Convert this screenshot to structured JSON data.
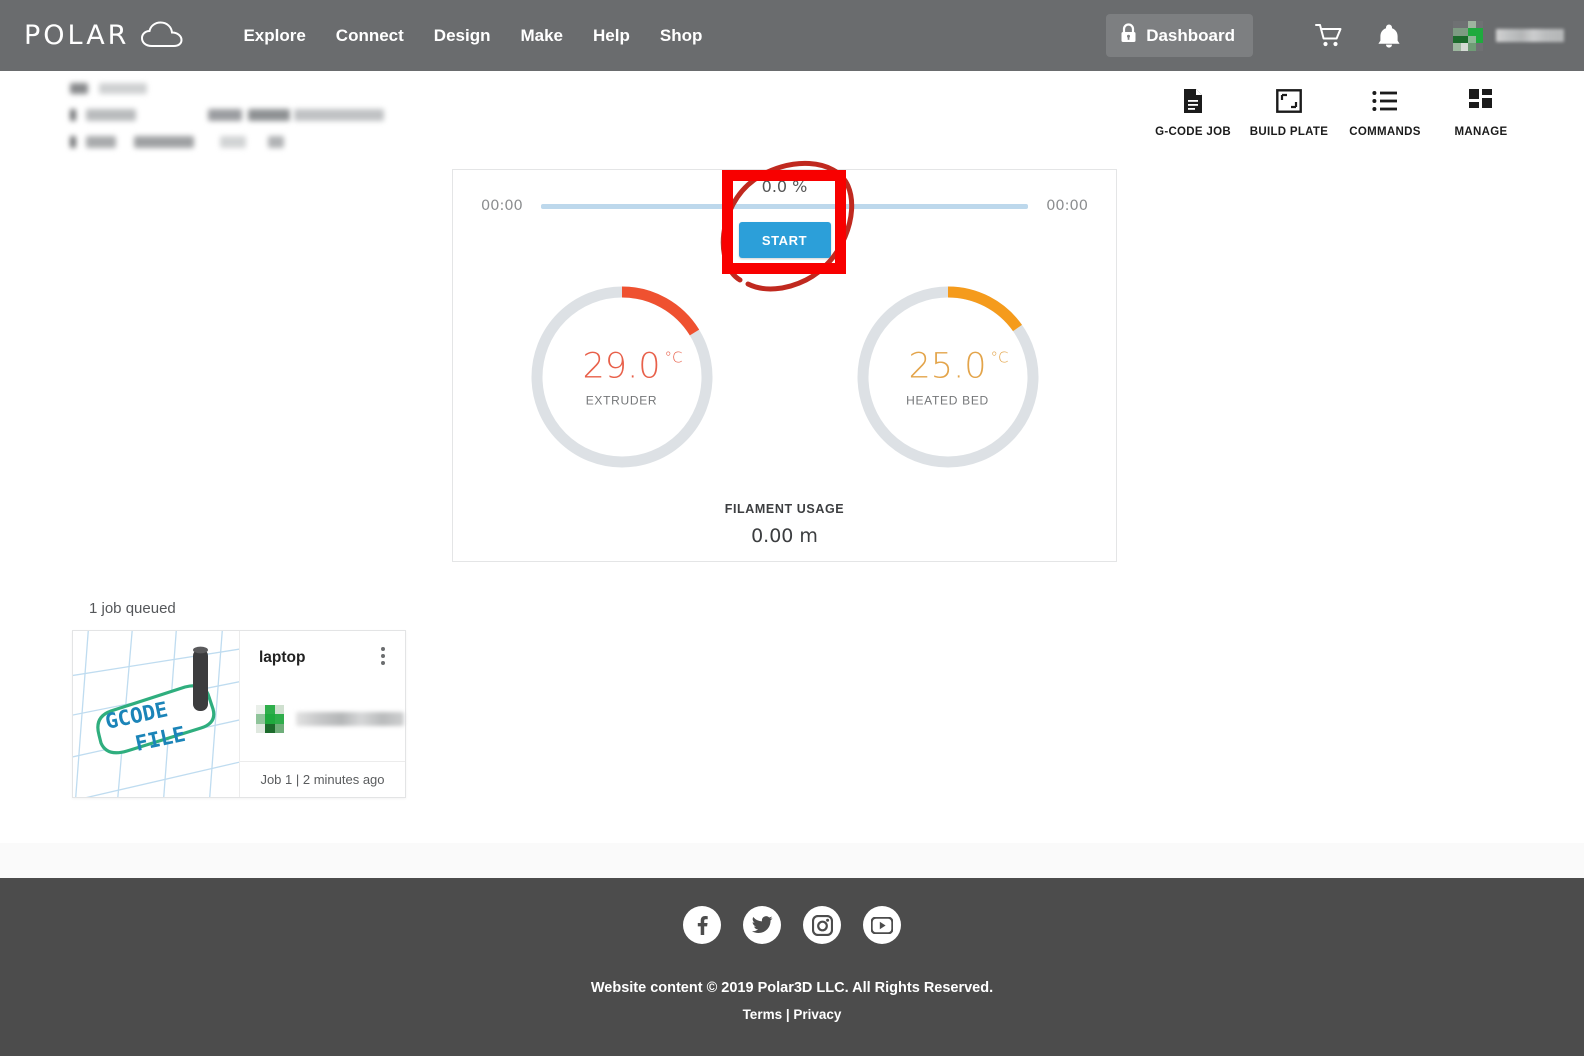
{
  "header": {
    "logo_text": "POLAR",
    "logo_icon": "cloud-icon",
    "nav": [
      {
        "label": "Explore"
      },
      {
        "label": "Connect"
      },
      {
        "label": "Design"
      },
      {
        "label": "Make"
      },
      {
        "label": "Help"
      },
      {
        "label": "Shop"
      }
    ],
    "dashboard_button": {
      "label": "Dashboard",
      "icon": "lock-icon"
    },
    "cart_icon": "shopping-cart-icon",
    "bell_icon": "notification-bell-icon",
    "avatar": "user-avatar-identicon",
    "username": "",
    "bg_color": "#6a6c6e"
  },
  "toolbar": {
    "items": [
      {
        "label": "G-CODE JOB",
        "icon": "document-icon"
      },
      {
        "label": "BUILD PLATE",
        "icon": "build-plate-frame-icon"
      },
      {
        "label": "COMMANDS",
        "icon": "list-icon"
      },
      {
        "label": "MANAGE",
        "icon": "grid-blocks-icon"
      }
    ]
  },
  "printer": {
    "name_redacted": "",
    "progress": {
      "elapsed": "00:00",
      "remaining": "00:00",
      "percent_label": "0.0 %",
      "percent_value": 0,
      "track_color": "#bdd8ec"
    },
    "start_button": {
      "label": "START",
      "color": "#2c9fd9"
    },
    "gauges": [
      {
        "name": "EXTRUDER",
        "value": "29.0",
        "unit": "°C",
        "color": "#ef5130",
        "track_color": "#dde1e5",
        "arc_fraction": 0.155
      },
      {
        "name": "HEATED BED",
        "value": "25.0",
        "unit": "°C",
        "color": "#f59b1c",
        "track_color": "#dde1e5",
        "arc_fraction": 0.145
      }
    ],
    "filament": {
      "label": "FILAMENT USAGE",
      "value": "0.00 m"
    }
  },
  "annotation": {
    "shape": "red-rectangle-and-circle-highlight",
    "color": "#f80000",
    "target": "START"
  },
  "queue": {
    "count_label": "1 job queued",
    "jobs": [
      {
        "title": "laptop",
        "thumbnail_text_line1": "GCODE",
        "thumbnail_text_line2": "FILE",
        "owner_redacted": "",
        "footer": "Job 1 | 2 minutes ago",
        "menu_icon": "kebab-menu-icon"
      }
    ]
  },
  "footer": {
    "social": [
      {
        "name": "facebook-icon"
      },
      {
        "name": "twitter-icon"
      },
      {
        "name": "instagram-icon"
      },
      {
        "name": "youtube-icon"
      }
    ],
    "copyright": "Website content © 2019 Polar3D LLC. All Rights Reserved.",
    "terms": "Terms",
    "separator": " | ",
    "privacy": "Privacy",
    "bg_color": "#4c4c4c"
  }
}
